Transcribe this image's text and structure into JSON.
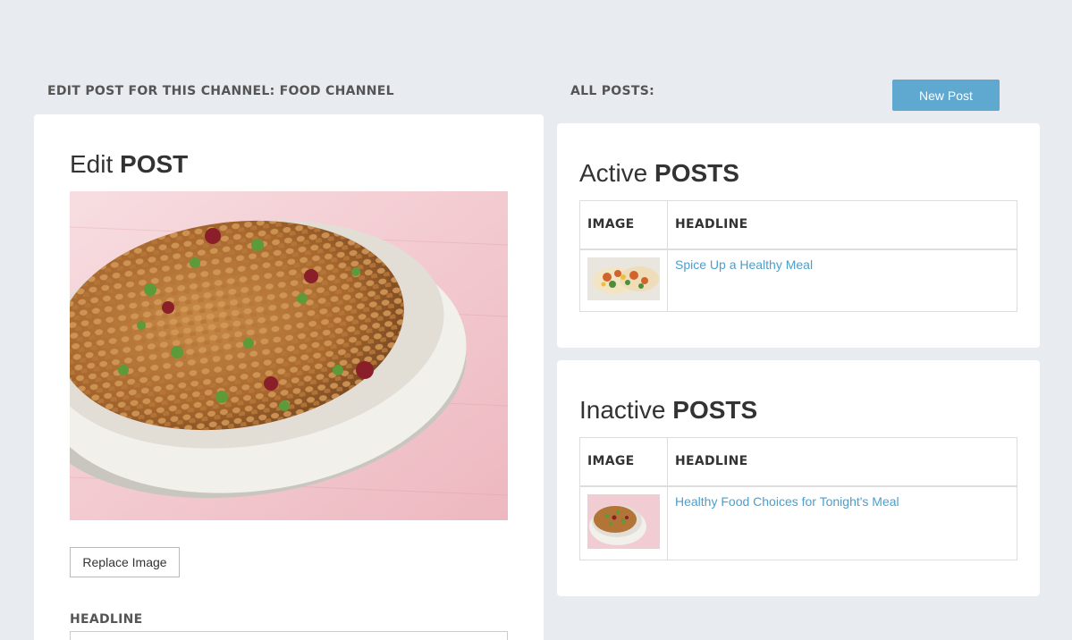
{
  "edit_section": {
    "label": "EDIT POST FOR THIS CHANNEL: FOOD CHANNEL",
    "title_light": "Edit",
    "title_strong": "POST",
    "replace_button": "Replace Image",
    "headline_label": "HEADLINE",
    "headline_value": ""
  },
  "posts_section": {
    "label": "ALL POSTS:",
    "new_post_button": "New Post",
    "active": {
      "title_light": "Active",
      "title_strong": "POSTS",
      "columns": [
        "IMAGE",
        "HEADLINE"
      ],
      "rows": [
        {
          "image_icon": "tacos-thumbnail",
          "headline": "Spice Up a Healthy Meal"
        }
      ]
    },
    "inactive": {
      "title_light": "Inactive",
      "title_strong": "POSTS",
      "columns": [
        "IMAGE",
        "HEADLINE"
      ],
      "rows": [
        {
          "image_icon": "grain-salad-thumbnail",
          "headline": "Healthy Food Choices for Tonight's Meal"
        }
      ]
    }
  },
  "colors": {
    "background": "#e8ecf0",
    "accent": "#5fa8cf",
    "link": "#4a9fcc",
    "card": "#ffffff"
  }
}
